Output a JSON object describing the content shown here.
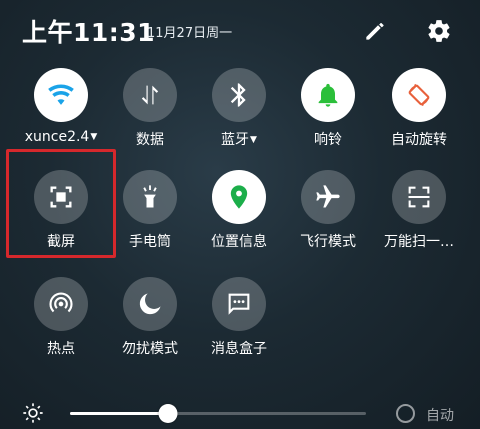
{
  "status": {
    "time": "上午11:31",
    "date": "11月27日周一"
  },
  "header_icons": [
    "pencil-icon",
    "gear-icon"
  ],
  "tiles": [
    {
      "label": "xunce2.4",
      "dropdown": true,
      "active": true,
      "icon": "wifi-icon"
    },
    {
      "label": "数据",
      "dropdown": false,
      "active": false,
      "icon": "data-arrows-icon"
    },
    {
      "label": "蓝牙",
      "dropdown": true,
      "active": false,
      "icon": "bluetooth-icon"
    },
    {
      "label": "响铃",
      "dropdown": false,
      "active": true,
      "icon": "bell-icon"
    },
    {
      "label": "自动旋转",
      "dropdown": false,
      "active": true,
      "icon": "rotate-icon"
    },
    {
      "label": "截屏",
      "dropdown": false,
      "active": false,
      "icon": "screenshot-icon"
    },
    {
      "label": "手电筒",
      "dropdown": false,
      "active": false,
      "icon": "flashlight-icon"
    },
    {
      "label": "位置信息",
      "dropdown": false,
      "active": true,
      "icon": "location-icon"
    },
    {
      "label": "飞行模式",
      "dropdown": false,
      "active": false,
      "icon": "airplane-icon"
    },
    {
      "label": "万能扫一…",
      "dropdown": false,
      "active": false,
      "icon": "scan-icon"
    },
    {
      "label": "热点",
      "dropdown": false,
      "active": false,
      "icon": "hotspot-icon"
    },
    {
      "label": "勿扰模式",
      "dropdown": false,
      "active": false,
      "icon": "moon-icon"
    },
    {
      "label": "消息盒子",
      "dropdown": false,
      "active": false,
      "icon": "message-icon"
    }
  ],
  "brightness": {
    "level": 0.33,
    "auto_label": "自动",
    "auto_enabled": false
  },
  "colors": {
    "wifi": "#1aa3e8",
    "bell": "#2bbf3a",
    "rotate": "#e8613c",
    "location": "#1cae4a",
    "highlight": "#d6282c"
  }
}
